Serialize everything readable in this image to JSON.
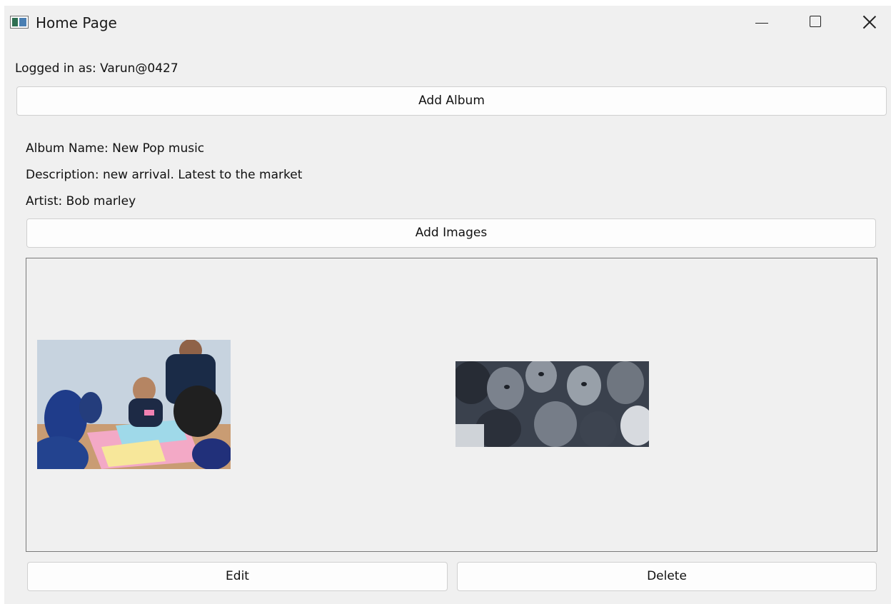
{
  "window": {
    "title": "Home Page",
    "controls": {
      "minimize_icon": "minimize-icon",
      "maximize_icon": "maximize-icon",
      "close_icon": "close-icon"
    }
  },
  "session": {
    "logged_in_text": "Logged in as: Varun@0427"
  },
  "actions": {
    "add_album_label": "Add Album",
    "add_images_label": "Add Images",
    "edit_label": "Edit",
    "delete_label": "Delete"
  },
  "album": {
    "name_line": "Album Name: New Pop music",
    "description_line": "Description: new arrival. Latest to the market",
    "artist_line": "Artist: Bob marley"
  },
  "images": [
    {
      "subject": "group-of-people-at-table-photo",
      "tone": "color"
    },
    {
      "subject": "children-faces-photo",
      "tone": "black-and-white"
    }
  ],
  "colors": {
    "window_background": "#f0f0f0",
    "button_background": "#fdfdfd",
    "button_border": "#d0d0d0",
    "panel_border": "#7a7a7a"
  }
}
